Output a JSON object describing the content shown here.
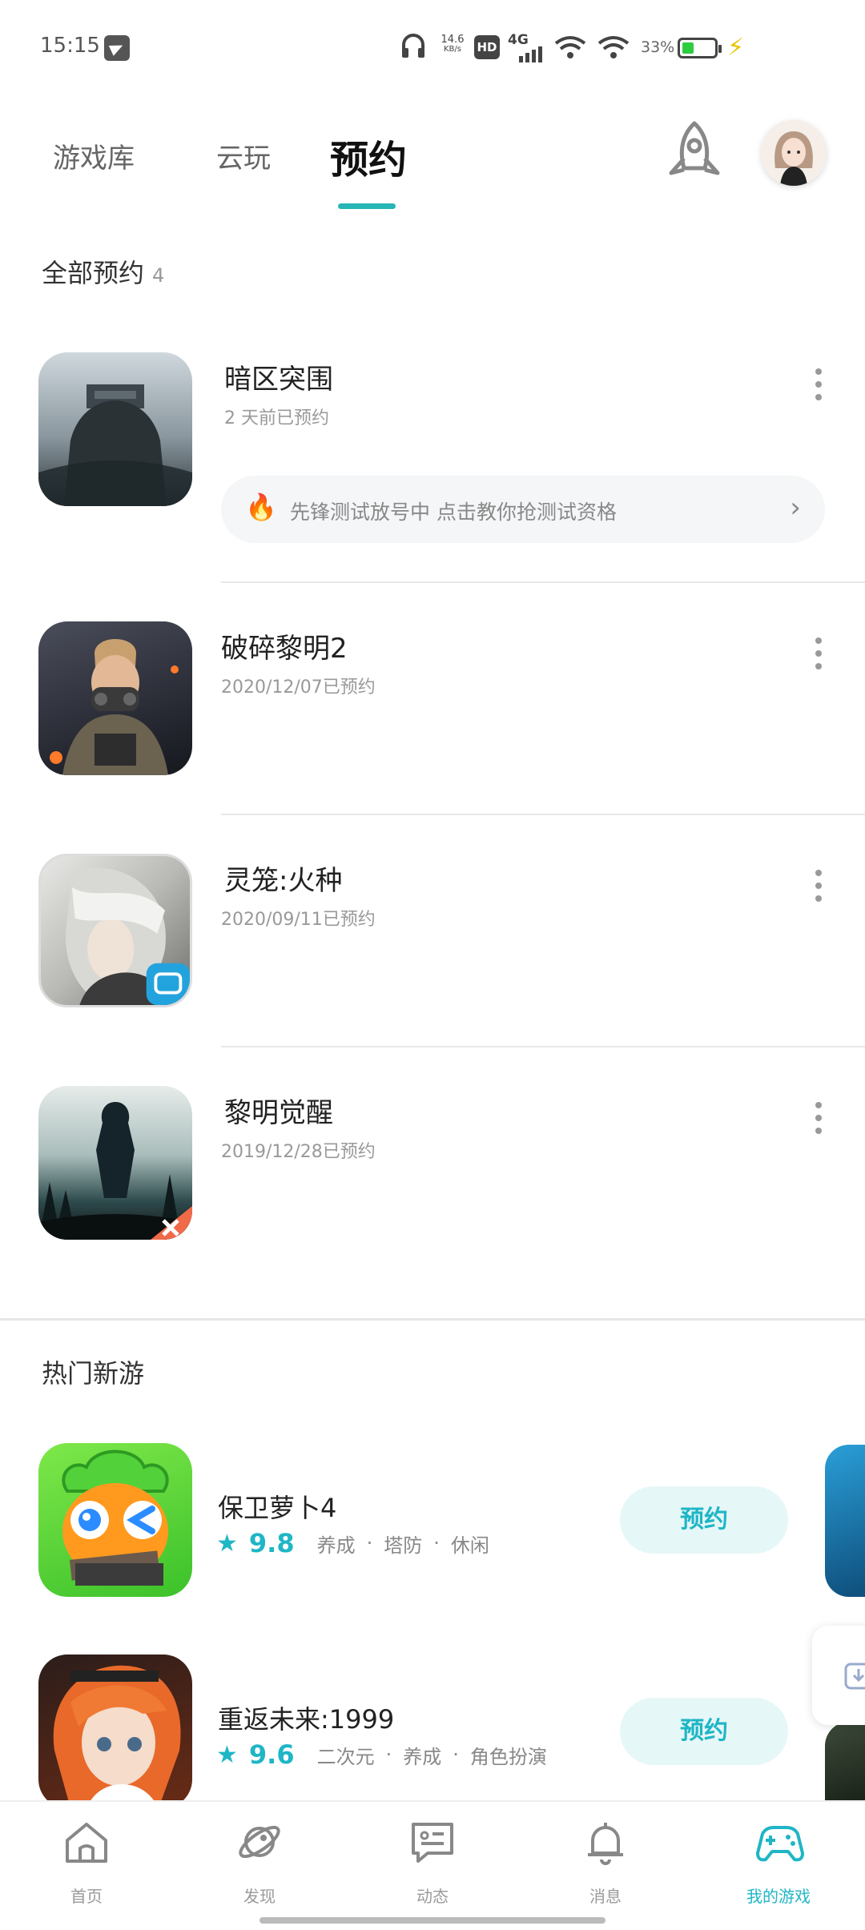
{
  "status_bar": {
    "time": "15:15",
    "net_speed": "14.6",
    "net_unit": "KB/s",
    "hd": "HD",
    "network": "4G",
    "battery": "33%"
  },
  "tabs": [
    {
      "label": "游戏库"
    },
    {
      "label": "云玩"
    },
    {
      "label": "预约"
    }
  ],
  "reservations": {
    "title": "全部预约",
    "count": "4",
    "promo": "先锋测试放号中 点击教你抢测试资格",
    "items": [
      {
        "name": "暗区突围",
        "date": "2 天前已预约"
      },
      {
        "name": "破碎黎明2",
        "date": "2020/12/07已预约"
      },
      {
        "name": "灵笼:火种",
        "date": "2020/09/11已预约"
      },
      {
        "name": "黎明觉醒",
        "date": "2019/12/28已预约"
      }
    ]
  },
  "hot_games": {
    "title": "热门新游",
    "items": [
      {
        "name": "保卫萝卜4",
        "score": "9.8",
        "tags": [
          "养成",
          "·",
          "塔防",
          "·",
          "休闲"
        ],
        "button": "预约"
      },
      {
        "name": "重返未来:1999",
        "score": "9.6",
        "tags": [
          "二次元",
          "·",
          "养成",
          "·",
          "角色扮演"
        ],
        "button": "预约"
      }
    ]
  },
  "bottom_nav": [
    {
      "label": "首页",
      "icon": "home-icon"
    },
    {
      "label": "发现",
      "icon": "planet-icon"
    },
    {
      "label": "动态",
      "icon": "chat-icon"
    },
    {
      "label": "消息",
      "icon": "bell-icon"
    },
    {
      "label": "我的游戏",
      "icon": "gamepad-icon"
    }
  ],
  "colors": {
    "accent": "#1fb6c6",
    "tab_indicator": "#27b6b6"
  }
}
